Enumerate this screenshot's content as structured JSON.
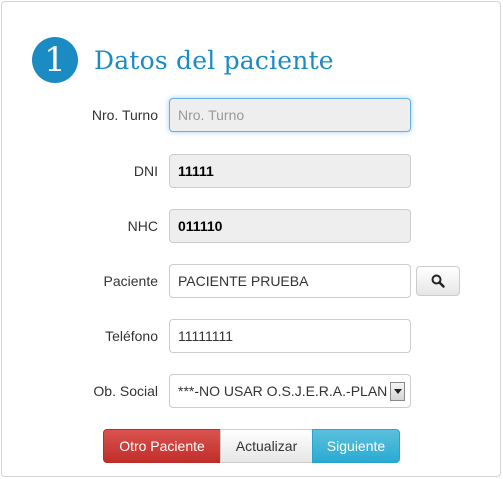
{
  "header": {
    "step_number": "1",
    "title": "Datos del paciente"
  },
  "form": {
    "turno": {
      "label": "Nro. Turno",
      "value": "",
      "placeholder": "Nro. Turno"
    },
    "dni": {
      "label": "DNI",
      "value": "11111"
    },
    "nhc": {
      "label": "NHC",
      "value": "011110"
    },
    "paciente": {
      "label": "Paciente",
      "value": "PACIENTE PRUEBA"
    },
    "telefono": {
      "label": "Teléfono",
      "value": "11111111"
    },
    "obra_social": {
      "label": "Ob. Social",
      "selected": "***-NO USAR O.S.J.E.R.A.-PLAN"
    }
  },
  "actions": {
    "otro_paciente": "Otro Paciente",
    "actualizar": "Actualizar",
    "siguiente": "Siguiente"
  },
  "icons": {
    "search": "search-icon",
    "dropdown": "dropdown-arrow-icon"
  },
  "colors": {
    "accent": "#1b8bc4",
    "danger": "#d9534f",
    "info": "#5bc0de"
  }
}
